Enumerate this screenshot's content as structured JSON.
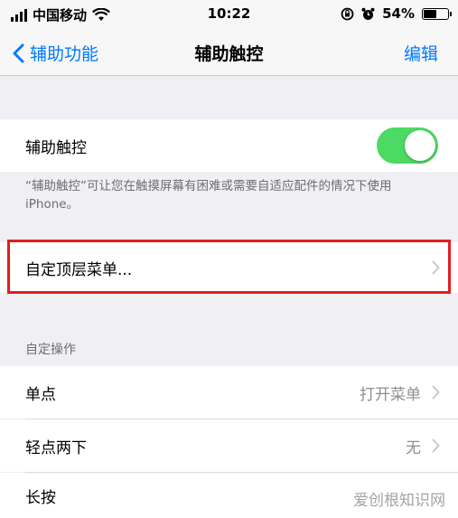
{
  "status_bar": {
    "carrier": "中国移动",
    "time": "10:22",
    "battery_percent": "54%",
    "battery_level": 0.54,
    "icons": [
      "signal-icon",
      "wifi-icon",
      "rotation-lock-icon",
      "alarm-icon",
      "battery-icon"
    ]
  },
  "nav": {
    "back_label": "辅助功能",
    "title": "辅助触控",
    "edit_label": "编辑"
  },
  "assistive_touch": {
    "label": "辅助触控",
    "enabled": true,
    "footnote": "“辅助触控”可让您在触摸屏幕有困难或需要自适应配件的情况下使用 iPhone。"
  },
  "customize_menu": {
    "label": "自定顶层菜单..."
  },
  "custom_actions": {
    "header": "自定操作",
    "rows": [
      {
        "label": "单点",
        "value": "打开菜单"
      },
      {
        "label": "轻点两下",
        "value": "无"
      },
      {
        "label": "长按",
        "value": ""
      }
    ]
  },
  "watermark": "爱创根知识网",
  "colors": {
    "accent": "#007aff",
    "toggle_on": "#4cd964",
    "highlight": "#e02020"
  }
}
